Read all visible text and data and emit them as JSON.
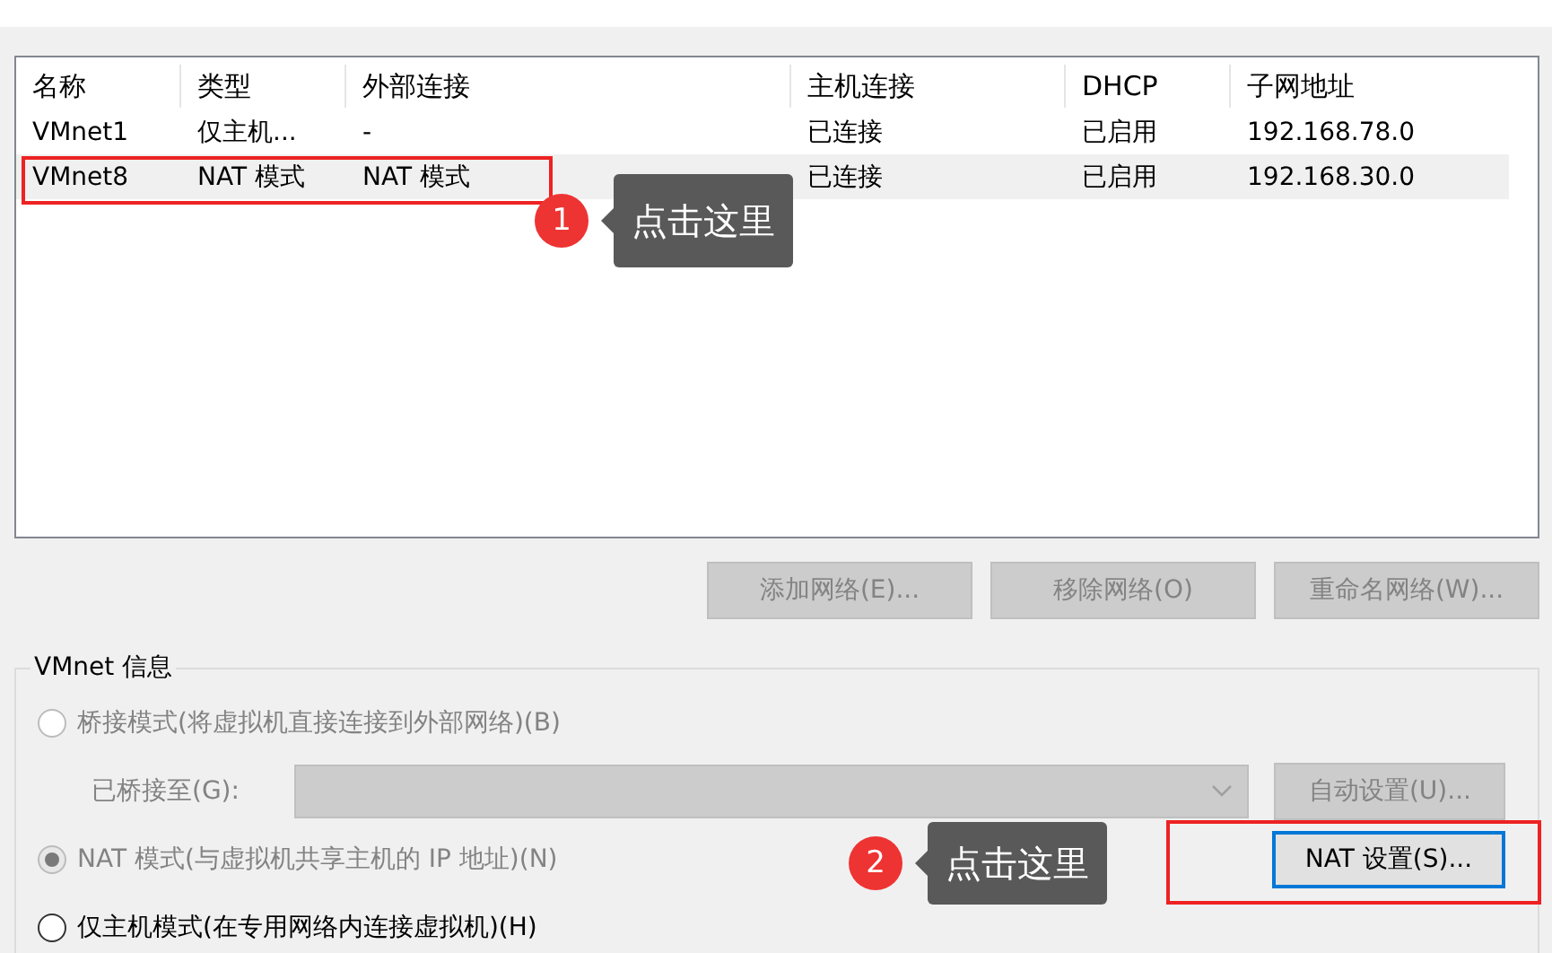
{
  "table": {
    "columns": [
      "名称",
      "类型",
      "外部连接",
      "主机连接",
      "DHCP",
      "子网地址"
    ],
    "rows": [
      {
        "cells": [
          "VMnet1",
          "仅主机...",
          "-",
          "已连接",
          "已启用",
          "192.168.78.0"
        ],
        "selected": false
      },
      {
        "cells": [
          "VMnet8",
          "NAT 模式",
          "NAT 模式",
          "已连接",
          "已启用",
          "192.168.30.0"
        ],
        "selected": true
      }
    ]
  },
  "table_buttons": [
    {
      "label": "添加网络(E)...",
      "disabled": true
    },
    {
      "label": "移除网络(O)",
      "disabled": true
    },
    {
      "label": "重命名网络(W)...",
      "disabled": true
    }
  ],
  "vmnet_info": {
    "title": "VMnet 信息",
    "options": [
      {
        "kind": "radio",
        "label": "桥接模式(将虚拟机直接连接到外部网络)(B)",
        "selected": false,
        "disabled": true
      },
      {
        "kind": "bridge",
        "label": "已桥接至(G):",
        "button": {
          "label": "自动设置(U)...",
          "disabled": true
        },
        "disabled": true
      },
      {
        "kind": "radio",
        "label": "NAT 模式(与虚拟机共享主机的 IP 地址)(N)",
        "selected": true,
        "disabled": true,
        "button": {
          "label": "NAT 设置(S)...",
          "disabled": false
        }
      },
      {
        "kind": "radio",
        "label": "仅主机模式(在专用网络内连接虚拟机)(H)",
        "selected": false,
        "disabled": false
      }
    ]
  },
  "annotations": [
    {
      "number": "1",
      "text": "点击这里"
    },
    {
      "number": "2",
      "text": "点击这里"
    }
  ]
}
